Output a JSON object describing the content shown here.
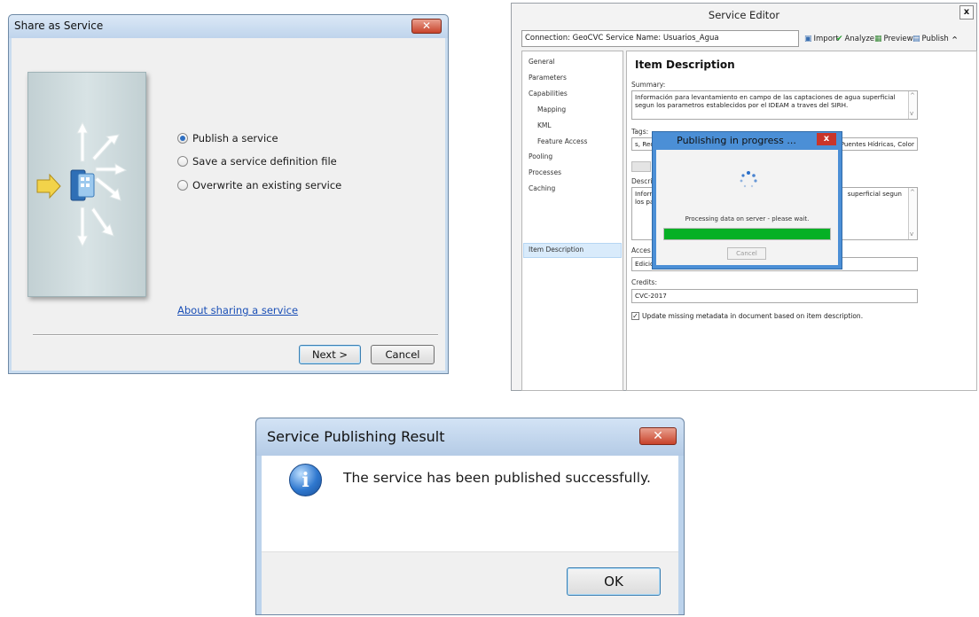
{
  "share_dialog": {
    "title": "Share as Service",
    "options": [
      {
        "label": "Publish a service",
        "selected": true
      },
      {
        "label": "Save a service definition file",
        "selected": false
      },
      {
        "label": "Overwrite an existing service",
        "selected": false
      }
    ],
    "help_link": "About sharing a service",
    "next_label": "Next >",
    "cancel_label": "Cancel"
  },
  "service_editor": {
    "title": "Service Editor",
    "close_label": "x",
    "connection_text": "Connection: GeoCVC   Service Name: Usuarios_Agua",
    "toolbar": {
      "import_label": "Import",
      "analyze_label": "Analyze",
      "preview_label": "Preview",
      "publish_label": "Publish"
    },
    "nav_items": [
      {
        "label": "General"
      },
      {
        "label": "Parameters"
      },
      {
        "label": "Capabilities"
      },
      {
        "label": "Mapping"
      },
      {
        "label": "KML"
      },
      {
        "label": "Feature Access"
      },
      {
        "label": "Pooling"
      },
      {
        "label": "Processes"
      },
      {
        "label": "Caching"
      },
      {
        "label": "Item Description"
      }
    ],
    "item_description": {
      "heading": "Item Description",
      "summary_label": "Summary:",
      "summary_text": "Información para levantamiento  en campo de las captaciones de agua superficial segun los parametros establecidos por el IDEAM a traves del SIRH.",
      "tags_label": "Tags:",
      "tags_left": "s, Rec",
      "tags_right": "Puentes Hídricas, Color",
      "description_label": "Descri",
      "description_left": "Inforr",
      "description_left2": "los pa",
      "description_right": "superficial segun",
      "access_label": "Acces",
      "access_value": "Edicio",
      "credits_label": "Credits:",
      "credits_value": "CVC-2017",
      "checkbox_label": "Update missing metadata in document based on item description.",
      "checkbox_checked": true
    }
  },
  "progress_dialog": {
    "title": "Publishing in progress ...",
    "close_label": "x",
    "message": "Processing data on server - please wait.",
    "progress": 1.0,
    "cancel_label": "Cancel"
  },
  "result_dialog": {
    "title": "Service Publishing Result",
    "message": "The service has been published successfully.",
    "ok_label": "OK"
  },
  "colors": {
    "link": "#1a4fb6",
    "progress_fill": "#06b025",
    "selection": "#d9ebfb"
  }
}
